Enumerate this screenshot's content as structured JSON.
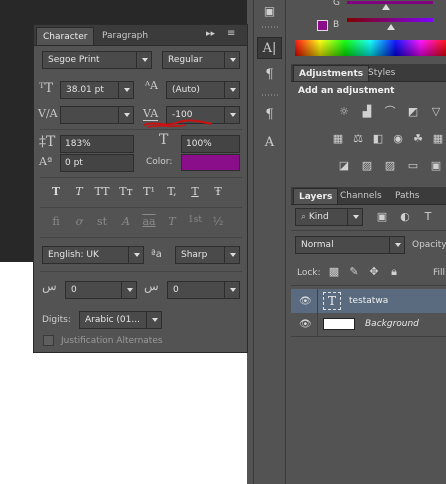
{
  "character_panel": {
    "tabs": [
      "Character",
      "Paragraph"
    ],
    "font_family": "Segoe Print",
    "font_style": "Regular",
    "font_size": "38.01 pt",
    "leading": "(Auto)",
    "kerning": "",
    "tracking": "-100",
    "vertical_scale": "183%",
    "horizontal_scale": "100%",
    "baseline_shift": "0 pt",
    "color_label": "Color:",
    "color_value": "#8a0d8a",
    "type_style_buttons": [
      "T",
      "T",
      "TT",
      "Tт",
      "T¹",
      "T,",
      "T",
      "Ŧ"
    ],
    "opentype_buttons": [
      "fi",
      "ơ",
      "st",
      "A",
      "aa",
      "T",
      "1st",
      "½"
    ],
    "language": "English: UK",
    "aa_label": "ªa",
    "antialias": "Sharp",
    "ligature_left_value": "0",
    "ligature_right_value": "0",
    "digits_label": "Digits:",
    "digits_value": "Arabic (01...",
    "justification_label": "Justification Alternates"
  },
  "color_panel": {
    "g_label": "G",
    "b_label": "B"
  },
  "adjustments_panel": {
    "tabs": [
      "Adjustments",
      "Styles"
    ],
    "heading": "Add an adjustment"
  },
  "layers_panel": {
    "tabs": [
      "Layers",
      "Channels",
      "Paths"
    ],
    "filter_kind": "Kind",
    "blend_mode": "Normal",
    "opacity_label": "Opacity",
    "lock_label": "Lock:",
    "fill_label": "Fill",
    "layers": [
      {
        "name": "testatwa",
        "type": "text"
      },
      {
        "name": "Background",
        "type": "image"
      }
    ]
  },
  "colors": {
    "purple": "#8a0d8a",
    "red_annotation": "#cc1111"
  }
}
